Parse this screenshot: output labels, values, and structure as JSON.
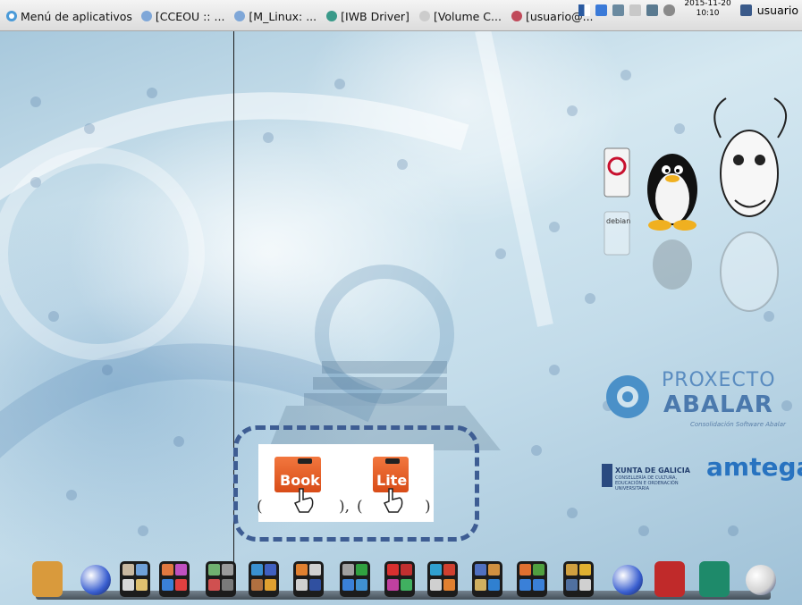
{
  "top_panel": {
    "menu_label": "Menú de aplicativos",
    "tasks": [
      {
        "label": "[CCEOU :: ...",
        "color": "#7fa7d8"
      },
      {
        "label": "[M_Linux: ...",
        "color": "#7fa7d8"
      },
      {
        "label": "[IWB Driver]",
        "color": "#3a9a8a"
      },
      {
        "label": "[Volume C...",
        "color": "#cccccc"
      },
      {
        "label": "[usuario@...",
        "color": "#c04a5a"
      }
    ],
    "clock_date": "2015-11-20",
    "clock_time": "10:10",
    "user_label": "usuario"
  },
  "annotation": {
    "tile_left_text": "Book",
    "tile_right_text": "Lite",
    "paren_open_1": "(",
    "paren_close_1": "),",
    "paren_open_2": "(",
    "paren_close_2": ")",
    "accent": "#3e5d93"
  },
  "branding": {
    "debian": "debian",
    "proxecto": "PROXECTO",
    "abalar": "ABALAR",
    "consolidacion": "Consolidación Software Abalar",
    "xunta": "XUNTA DE GALICIA",
    "conselleria": "CONSELLERÍA DE CULTURA, EDUCACIÓN E ORDENACIÓN UNIVERSITARIA",
    "amtega": "amtega"
  },
  "dock": {
    "items": [
      {
        "name": "file-cabinet",
        "kind": "single",
        "color": "#d99a3c"
      },
      {
        "name": "web-browser",
        "kind": "globe",
        "color": "#3a5fd0"
      },
      {
        "name": "apps-group-1",
        "kind": "quad",
        "colors": [
          "#c8b8a0",
          "#6fa0d8",
          "#d8d8d8",
          "#e0c070"
        ]
      },
      {
        "name": "apps-group-2",
        "kind": "quad",
        "colors": [
          "#e07840",
          "#c050c0",
          "#3a80d8",
          "#e04040"
        ]
      },
      {
        "name": "apps-group-3",
        "kind": "quad",
        "colors": [
          "#70b070",
          "#9a9a9a",
          "#d05050",
          "#7a7a7a"
        ]
      },
      {
        "name": "apps-group-4",
        "kind": "quad",
        "colors": [
          "#3a90d0",
          "#4060c0",
          "#b07040",
          "#e0a030"
        ]
      },
      {
        "name": "apps-group-5",
        "kind": "quad",
        "colors": [
          "#e08030",
          "#d0d0d0",
          "#d0d0d0",
          "#3050a0"
        ]
      },
      {
        "name": "apps-group-6",
        "kind": "quad",
        "colors": [
          "#a0a0a0",
          "#30a040",
          "#3a80d8",
          "#4090d0"
        ]
      },
      {
        "name": "apps-group-7",
        "kind": "quad",
        "colors": [
          "#d83030",
          "#c03030",
          "#c040a0",
          "#40b060"
        ]
      },
      {
        "name": "apps-group-8",
        "kind": "quad",
        "colors": [
          "#30a0d0",
          "#d04030",
          "#d0d0d0",
          "#e08030"
        ]
      },
      {
        "name": "apps-group-9",
        "kind": "quad",
        "colors": [
          "#5070c0",
          "#d09040",
          "#d0b060",
          "#3080d0"
        ]
      },
      {
        "name": "apps-group-10",
        "kind": "quad",
        "colors": [
          "#e07030",
          "#50a040",
          "#3a80d8",
          "#3a80d8"
        ]
      },
      {
        "name": "apps-group-11",
        "kind": "quad",
        "colors": [
          "#d0a040",
          "#e0b030",
          "#5070a0",
          "#d0d0d0"
        ]
      },
      {
        "name": "web-browser-2",
        "kind": "globe",
        "color": "#3a5fd0"
      },
      {
        "name": "presentation-app",
        "kind": "single",
        "color": "#c02a2a"
      },
      {
        "name": "whiteboard-app",
        "kind": "single",
        "color": "#1e8a6a"
      },
      {
        "name": "power-app",
        "kind": "globe",
        "color": "#d0d0d0"
      }
    ]
  }
}
